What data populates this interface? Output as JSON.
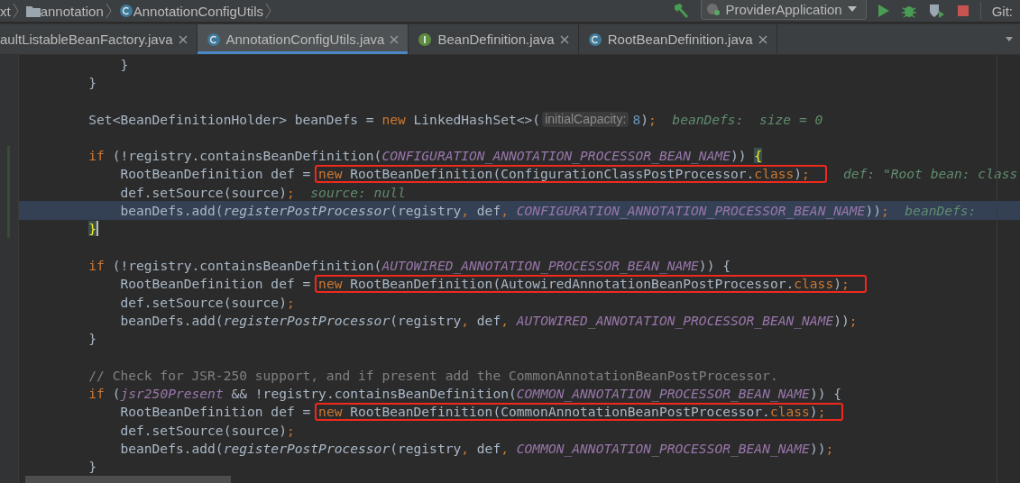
{
  "breadcrumbs": [
    {
      "label": "xt",
      "kind": "plain"
    },
    {
      "label": "annotation",
      "kind": "folder"
    },
    {
      "label": "AnnotationConfigUtils",
      "kind": "class"
    }
  ],
  "run_config": {
    "label": "ProviderApplication"
  },
  "vcs": {
    "label": "Git:"
  },
  "tabs": [
    {
      "label": "aultListableBeanFactory.java",
      "kind": "none",
      "selected": false
    },
    {
      "label": "AnnotationConfigUtils.java",
      "kind": "class",
      "selected": true
    },
    {
      "label": "BeanDefinition.java",
      "kind": "interface",
      "selected": false
    },
    {
      "label": "RootBeanDefinition.java",
      "kind": "class",
      "selected": false
    }
  ],
  "code": [
    {
      "tokens": [
        {
          "kind": "text",
          "text": "            }"
        }
      ]
    },
    {
      "blank_after": true,
      "tokens": [
        {
          "kind": "text",
          "text": "        }"
        }
      ]
    },
    {
      "tokens": [
        {
          "kind": "text",
          "text": "        Set<BeanDefinitionHolder> beanDefs = "
        },
        {
          "kind": "keyword",
          "text": "new"
        },
        {
          "kind": "text",
          "text": " LinkedHashSet<>("
        },
        {
          "kind": "inlay",
          "text": "initialCapacity:"
        },
        {
          "kind": "number",
          "text": "8"
        },
        {
          "kind": "text",
          "text": ")"
        },
        {
          "kind": "keyword",
          "text": ";"
        },
        {
          "kind": "hint",
          "text": "beanDefs:  size = 0"
        }
      ],
      "blank_after": true
    },
    {
      "changed": true,
      "tokens": [
        {
          "kind": "keyword",
          "text": "        if"
        },
        {
          "kind": "text",
          "text": " (!registry.containsBeanDefinition("
        },
        {
          "kind": "const",
          "text": "CONFIGURATION_ANNOTATION_PROCESSOR_BEAN_NAME"
        },
        {
          "kind": "text",
          "text": ")) "
        },
        {
          "kind": "brace",
          "text": "{"
        }
      ]
    },
    {
      "changed": true,
      "tokens": [
        {
          "kind": "text",
          "text": "            RootBeanDefinition def = "
        },
        {
          "kind": "box",
          "tokens": [
            {
              "kind": "keyword",
              "text": "new"
            },
            {
              "kind": "text",
              "text": " RootBeanDefinition(ConfigurationClassPostProcessor."
            },
            {
              "kind": "keyword",
              "text": "class"
            },
            {
              "kind": "text",
              "text": ")"
            },
            {
              "kind": "keyword",
              "text": ";"
            }
          ]
        },
        {
          "kind": "hint",
          "text": "def: \"Root bean: class"
        }
      ]
    },
    {
      "changed": true,
      "tokens": [
        {
          "kind": "text",
          "text": "            def.setSource(source)"
        },
        {
          "kind": "keyword",
          "text": ";"
        },
        {
          "kind": "hint",
          "text": "source: null"
        }
      ]
    },
    {
      "changed": true,
      "highlighted": true,
      "tokens": [
        {
          "kind": "text",
          "text": "            beanDefs.add("
        },
        {
          "kind": "method",
          "text": "registerPostProcessor"
        },
        {
          "kind": "text",
          "text": "(registry"
        },
        {
          "kind": "keyword",
          "text": ","
        },
        {
          "kind": "text",
          "text": " def"
        },
        {
          "kind": "keyword",
          "text": ","
        },
        {
          "kind": "const",
          "text": " CONFIGURATION_ANNOTATION_PROCESSOR_BEAN_NAME"
        },
        {
          "kind": "text",
          "text": "))"
        },
        {
          "kind": "keyword",
          "text": ";"
        },
        {
          "kind": "hint",
          "text": "beanDefs:"
        }
      ]
    },
    {
      "changed": true,
      "caret": true,
      "blank_after": true,
      "tokens": [
        {
          "kind": "brace",
          "text": "        }"
        }
      ]
    },
    {
      "tokens": [
        {
          "kind": "keyword",
          "text": "        if"
        },
        {
          "kind": "text",
          "text": " (!registry.containsBeanDefinition("
        },
        {
          "kind": "const",
          "text": "AUTOWIRED_ANNOTATION_PROCESSOR_BEAN_NAME"
        },
        {
          "kind": "text",
          "text": ")) {"
        }
      ]
    },
    {
      "tokens": [
        {
          "kind": "text",
          "text": "            RootBeanDefinition def = "
        },
        {
          "kind": "box",
          "tokens": [
            {
              "kind": "keyword",
              "text": "new"
            },
            {
              "kind": "text",
              "text": " RootBeanDefinition(AutowiredAnnotationBeanPostProcessor."
            },
            {
              "kind": "keyword",
              "text": "class"
            },
            {
              "kind": "text",
              "text": ")"
            },
            {
              "kind": "keyword",
              "text": ";"
            }
          ]
        }
      ]
    },
    {
      "tokens": [
        {
          "kind": "text",
          "text": "            def.setSource(source)"
        },
        {
          "kind": "keyword",
          "text": ";"
        }
      ]
    },
    {
      "tokens": [
        {
          "kind": "text",
          "text": "            beanDefs.add("
        },
        {
          "kind": "method",
          "text": "registerPostProcessor"
        },
        {
          "kind": "text",
          "text": "(registry"
        },
        {
          "kind": "keyword",
          "text": ","
        },
        {
          "kind": "text",
          "text": " def"
        },
        {
          "kind": "keyword",
          "text": ","
        },
        {
          "kind": "const",
          "text": " AUTOWIRED_ANNOTATION_PROCESSOR_BEAN_NAME"
        },
        {
          "kind": "text",
          "text": "))"
        },
        {
          "kind": "keyword",
          "text": ";"
        }
      ]
    },
    {
      "blank_after": true,
      "tokens": [
        {
          "kind": "text",
          "text": "        }"
        }
      ]
    },
    {
      "tokens": [
        {
          "kind": "comment",
          "text": "        // Check for JSR-250 support, and if present add the CommonAnnotationBeanPostProcessor."
        }
      ]
    },
    {
      "tokens": [
        {
          "kind": "keyword",
          "text": "        if"
        },
        {
          "kind": "text",
          "text": " ("
        },
        {
          "kind": "const",
          "text": "jsr250Present"
        },
        {
          "kind": "text",
          "text": " && !registry.containsBeanDefinition("
        },
        {
          "kind": "const",
          "text": "COMMON_ANNOTATION_PROCESSOR_BEAN_NAME"
        },
        {
          "kind": "text",
          "text": ")) {"
        }
      ]
    },
    {
      "tokens": [
        {
          "kind": "text",
          "text": "            RootBeanDefinition def = "
        },
        {
          "kind": "box",
          "tokens": [
            {
              "kind": "keyword",
              "text": "new"
            },
            {
              "kind": "text",
              "text": " RootBeanDefinition(CommonAnnotationBeanPostProcessor."
            },
            {
              "kind": "keyword",
              "text": "class"
            },
            {
              "kind": "text",
              "text": ")"
            },
            {
              "kind": "keyword",
              "text": ";"
            }
          ]
        }
      ]
    },
    {
      "tokens": [
        {
          "kind": "text",
          "text": "            def.setSource(source)"
        },
        {
          "kind": "keyword",
          "text": ";"
        }
      ]
    },
    {
      "tokens": [
        {
          "kind": "text",
          "text": "            beanDefs.add("
        },
        {
          "kind": "method",
          "text": "registerPostProcessor"
        },
        {
          "kind": "text",
          "text": "(registry"
        },
        {
          "kind": "keyword",
          "text": ","
        },
        {
          "kind": "text",
          "text": " def"
        },
        {
          "kind": "keyword",
          "text": ","
        },
        {
          "kind": "const",
          "text": " COMMON_ANNOTATION_PROCESSOR_BEAN_NAME"
        },
        {
          "kind": "text",
          "text": "))"
        },
        {
          "kind": "keyword",
          "text": ";"
        }
      ]
    },
    {
      "tokens": [
        {
          "kind": "text",
          "text": "        }"
        }
      ]
    }
  ]
}
